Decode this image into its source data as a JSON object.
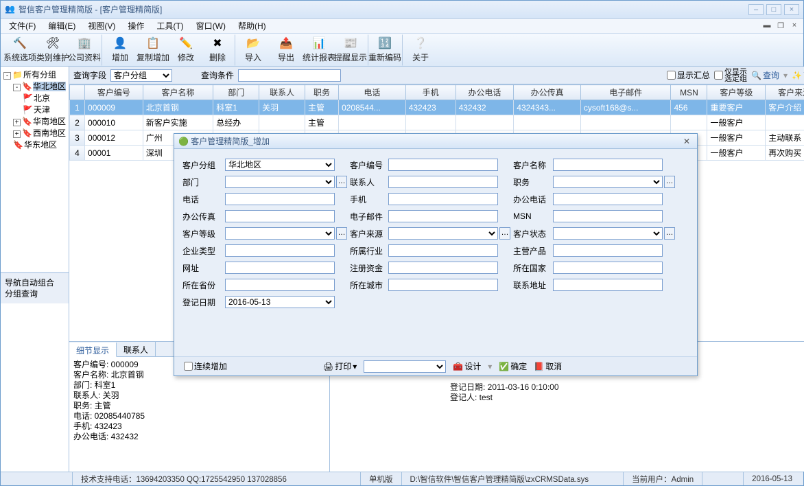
{
  "window": {
    "title": "智信客户管理精简版 - [客户管理精简版]"
  },
  "menu": {
    "file": "文件(F)",
    "edit": "编辑(E)",
    "view": "视图(V)",
    "action": "操作",
    "tool": "工具(T)",
    "window": "窗口(W)",
    "help": "帮助(H)"
  },
  "toolbar": {
    "sysopt": "系统选项",
    "catmaint": "类别维护",
    "company": "公司资料",
    "add": "增加",
    "copyadd": "复制增加",
    "modify": "修改",
    "delete": "删除",
    "import": "导入",
    "export": "导出",
    "report": "统计报表",
    "remind": "提醒显示",
    "renum": "重新编码",
    "about": "关于"
  },
  "tree": {
    "root": "所有分组",
    "hb": "华北地区",
    "bj": "北京",
    "tj": "天津",
    "hn": "华南地区",
    "xn": "西南地区",
    "hd": "华东地区"
  },
  "nav": {
    "autogroup": "导航自动组合",
    "groupquery": "分组查询"
  },
  "filter": {
    "fieldLbl": "查询字段",
    "field": "客户分组",
    "condLbl": "查询条件",
    "showSum": "显示汇总",
    "onlySel": "仅显示\n选定组",
    "query": "查询",
    "adv": "高级"
  },
  "grid": {
    "cols": [
      "",
      "客户编号",
      "客户名称",
      "部门",
      "联系人",
      "职务",
      "电话",
      "手机",
      "办公电话",
      "办公传真",
      "电子邮件",
      "MSN",
      "客户等级",
      "客户来源"
    ],
    "rows": [
      {
        "n": "1",
        "id": "000009",
        "name": "北京首钢",
        "dept": "科室1",
        "contact": "关羽",
        "title": "主管",
        "tel": "0208544...",
        "mob": "432423",
        "otel": "432432",
        "ofax": "4324343...",
        "mail": "cysoft168@s...",
        "msn": "456",
        "lvl": "重要客户",
        "src": "客户介绍",
        "sel": true
      },
      {
        "n": "2",
        "id": "000010",
        "name": "新客户实施",
        "dept": "总经办",
        "contact": "",
        "title": "主管",
        "tel": "",
        "mob": "",
        "otel": "",
        "ofax": "",
        "mail": "",
        "msn": "",
        "lvl": "一般客户",
        "src": ""
      },
      {
        "n": "3",
        "id": "000012",
        "name": "广州",
        "dept": "",
        "contact": "",
        "title": "",
        "tel": "",
        "mob": "",
        "otel": "",
        "ofax": "",
        "mail": "",
        "msn": "",
        "lvl": "一般客户",
        "src": "主动联系"
      },
      {
        "n": "4",
        "id": "00001",
        "name": "深圳",
        "dept": "",
        "contact": "",
        "title": "",
        "tel": "",
        "mob": "",
        "otel": "",
        "ofax": "",
        "mail": "",
        "msn": "",
        "lvl": "一般客户",
        "src": "再次购买"
      }
    ]
  },
  "tabs": {
    "detail": "细节显示",
    "contact": "联系人"
  },
  "detail": {
    "l1": "客户编号: 000009",
    "l2": "客户名称: 北京首钢",
    "l3": "部门: 科室1",
    "l4": "联系人: 关羽",
    "l5": "职务: 主管",
    "l6": "电话: 02085440785",
    "l7": "手机: 432423",
    "l8": "办公电话: 432432"
  },
  "extra": {
    "regdate": "登记日期: 2011-03-16 0:10:00",
    "reguser": "登记人: test"
  },
  "dialog": {
    "title": "客户管理精简版_增加",
    "group": "客户分组",
    "groupVal": "华北地区",
    "code": "客户编号",
    "name": "客户名称",
    "dept": "部门",
    "contact": "联系人",
    "title_": "职务",
    "tel": "电话",
    "mob": "手机",
    "otel": "办公电话",
    "ofax": "办公传真",
    "mail": "电子邮件",
    "msn": "MSN",
    "lvl": "客户等级",
    "src": "客户来源",
    "state": "客户状态",
    "etype": "企业类型",
    "ind": "所属行业",
    "prod": "主营产品",
    "url": "网址",
    "cap": "注册资金",
    "ctry": "所在国家",
    "prov": "所在省份",
    "city": "所在城市",
    "addr": "联系地址",
    "regd": "登记日期",
    "regdVal": "2016-05-13",
    "continuous": "连续增加",
    "print": "打印",
    "design": "设计",
    "ok": "确定",
    "cancel": "取消"
  },
  "status": {
    "tech": "技术支持电话：13694203350 QQ:1725542950 137028856",
    "mode": "单机版",
    "path": "D:\\智信软件\\智信客户管理精简版\\zxCRMSData.sys",
    "user": "当前用户：Admin",
    "date": "2016-05-13"
  }
}
